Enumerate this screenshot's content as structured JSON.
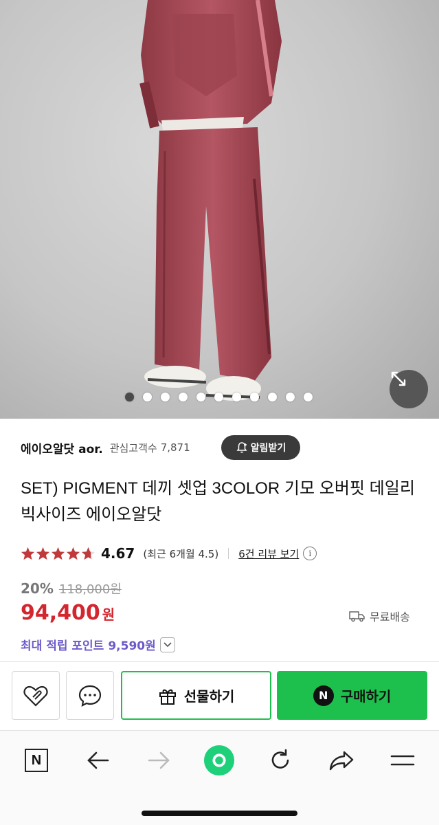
{
  "gallery": {
    "slide_count": 11,
    "active_index": 0
  },
  "seller": {
    "name": "에이오알닷 aor.",
    "follower_label": "관심고객수",
    "follower_count": "7,871",
    "alarm_label": "알림받기"
  },
  "product": {
    "title": "SET) PIGMENT 데끼 셋업 3COLOR 기모 오버핏 데일리 빅사이즈 에이오알닷"
  },
  "rating": {
    "score": "4.67",
    "stars_value": 4.67,
    "stars_max": 5,
    "recent": "(최근 6개월 4.5)",
    "review_link": "6건 리뷰 보기"
  },
  "price": {
    "discount_rate": "20%",
    "original": "118,000원",
    "sale": "94,400",
    "unit": "원",
    "shipping": "무료배송"
  },
  "points": {
    "label": "최대 적립 포인트",
    "value": "9,590원"
  },
  "actions": {
    "gift_label": "선물하기",
    "buy_label": "구매하기",
    "npay_letter": "N"
  },
  "browser": {
    "home_letter": "N"
  },
  "colors": {
    "price_red": "#d4262e",
    "naver_green": "#1ec04d",
    "points_purple": "#6c5ac8",
    "star_red": "#c0393b"
  }
}
